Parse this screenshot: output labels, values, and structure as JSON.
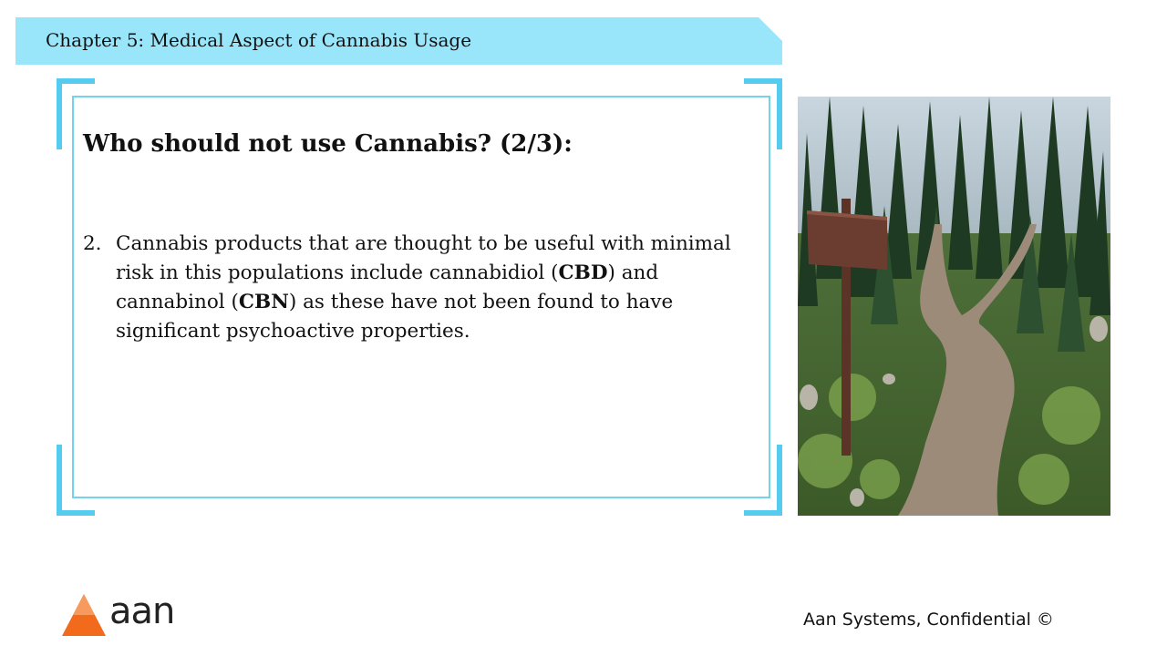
{
  "header": {
    "chapter_title": "Chapter 5: Medical Aspect of Cannabis Usage"
  },
  "slide": {
    "title": "Who should not use Cannabis? (2/3):",
    "point": {
      "number": "2.",
      "text_1": "Cannabis products that are thought to be useful with minimal risk in this populations include cannabidiol (",
      "bold_1": "CBD",
      "text_2": ") and cannabinol (",
      "bold_2": "CBN",
      "text_3": ") as these have not been found to have significant psychoactive properties."
    }
  },
  "logo": {
    "text": "aan"
  },
  "footer": {
    "text": "Aan Systems, Confidential ©"
  },
  "colors": {
    "header_band": "#99e6fa",
    "frame": "#55ccef",
    "logo_orange": "#f26b1d"
  }
}
